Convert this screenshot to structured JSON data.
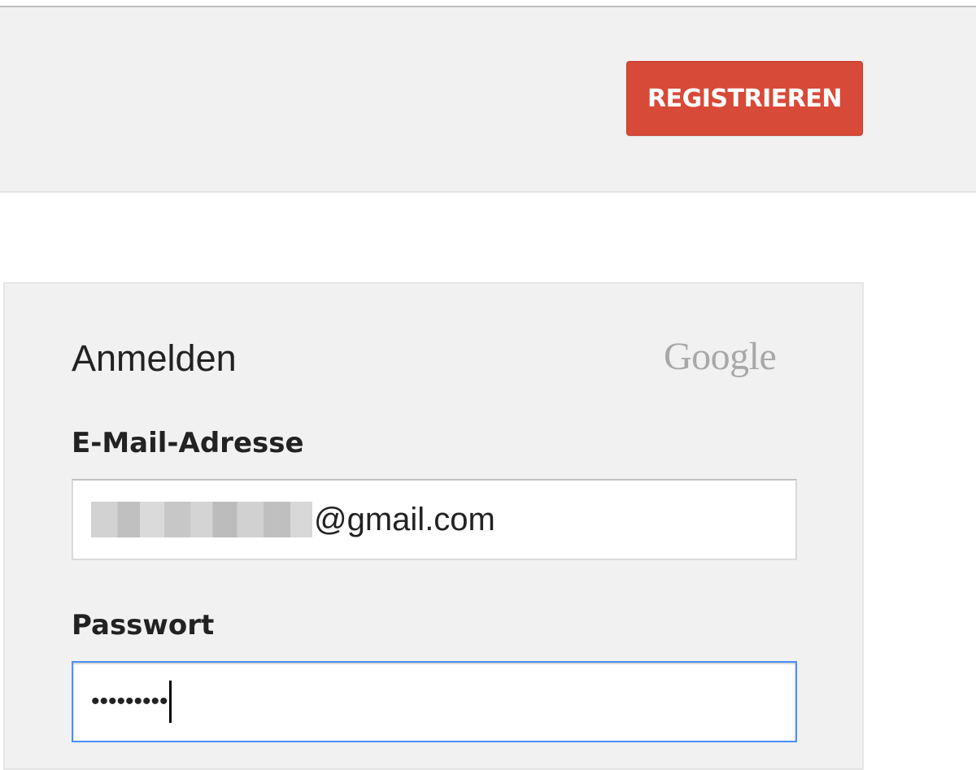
{
  "header": {
    "register_label": "REGISTRIEREN"
  },
  "signin": {
    "title": "Anmelden",
    "logo_text": "Google",
    "email": {
      "label": "E-Mail-Adresse",
      "value_suffix": "@gmail.com"
    },
    "password": {
      "label": "Passwort",
      "masked_value": "•••••••••"
    }
  },
  "colors": {
    "register_button": "#d84a38",
    "focus_border": "#4d90fe",
    "panel_background": "#f1f1f1"
  }
}
